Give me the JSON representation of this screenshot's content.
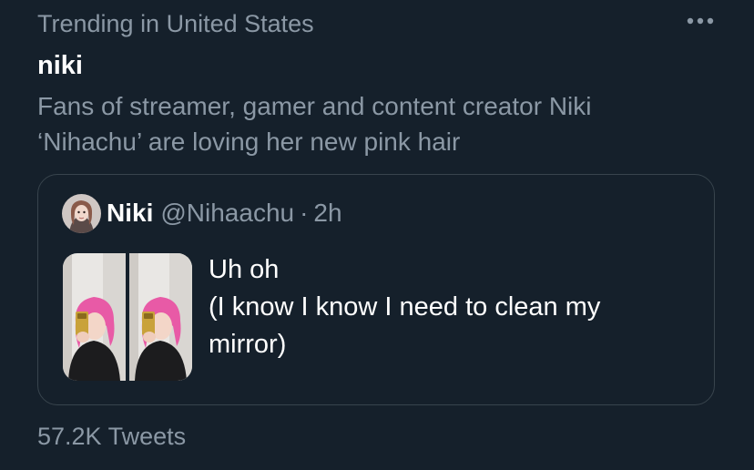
{
  "trend": {
    "context": "Trending in United States",
    "topic": "niki",
    "summary_lines": [
      "Fans of streamer, gamer and content creator Niki",
      "‘Nihachu’ are loving her new pink hair"
    ],
    "tweet_count": "57.2K Tweets"
  },
  "icons": {
    "more": "more-horizontal-icon"
  },
  "quoted_tweet": {
    "display_name": "Niki",
    "handle": "@Nihaachu",
    "separator": "·",
    "time": "2h",
    "text_lines": [
      "Uh oh",
      "(I know I know I need to clean my",
      "mirror)"
    ],
    "media_count": 2
  },
  "colors": {
    "background": "#15202b",
    "secondary_text": "#8b98a5",
    "primary_text": "#ffffff",
    "border": "#38444d",
    "hair_pink": "#e85aa6"
  }
}
